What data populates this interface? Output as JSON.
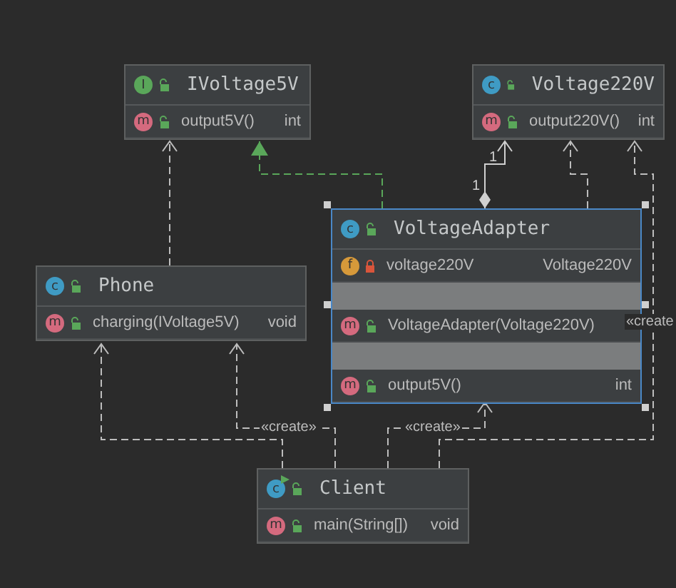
{
  "classes": [
    {
      "kind": "interface",
      "badge": "I",
      "name": "IVoltage5V",
      "selected": false,
      "sections": [
        [
          {
            "kind": "method",
            "badge": "m",
            "private": false,
            "name": "output5V()",
            "type": "int"
          }
        ]
      ]
    },
    {
      "kind": "class",
      "badge": "c",
      "name": "Voltage220V",
      "selected": false,
      "sections": [
        [
          {
            "kind": "method",
            "badge": "m",
            "private": false,
            "name": "output220V()",
            "type": "int"
          }
        ]
      ]
    },
    {
      "kind": "class",
      "badge": "c",
      "name": "Phone",
      "selected": false,
      "sections": [
        [
          {
            "kind": "method",
            "badge": "m",
            "private": false,
            "name": "charging(IVoltage5V)",
            "type": "void"
          }
        ]
      ]
    },
    {
      "kind": "class",
      "badge": "c",
      "name": "VoltageAdapter",
      "selected": true,
      "sections": [
        [
          {
            "kind": "field",
            "badge": "f",
            "private": true,
            "name": "voltage220V",
            "type": "Voltage220V"
          }
        ],
        [
          {
            "kind": "method",
            "badge": "m",
            "private": false,
            "name": "VoltageAdapter(Voltage220V)"
          }
        ],
        [
          {
            "kind": "method",
            "badge": "m",
            "private": false,
            "name": "output5V()",
            "type": "int"
          }
        ]
      ]
    },
    {
      "kind": "main-class",
      "badge": "c",
      "name": "Client",
      "selected": false,
      "sections": [
        [
          {
            "kind": "method",
            "badge": "m",
            "private": false,
            "name": "main(String[])",
            "type": "void"
          }
        ]
      ]
    }
  ],
  "edges": [
    {
      "kind": "dependency"
    },
    {
      "kind": "realization"
    },
    {
      "kind": "aggregation",
      "source_multiplicity": "1",
      "target_multiplicity": "1"
    },
    {
      "kind": "dependency"
    },
    {
      "kind": "dependency",
      "label": "«create"
    },
    {
      "kind": "dependency"
    },
    {
      "kind": "dependency",
      "label": "«create»"
    },
    {
      "kind": "dependency",
      "label": "«create»"
    }
  ]
}
